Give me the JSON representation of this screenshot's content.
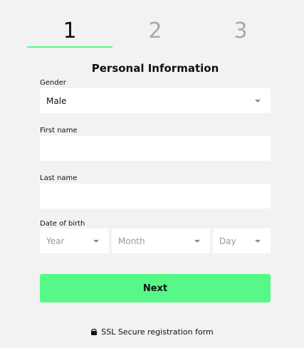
{
  "steps": [
    {
      "label": "1",
      "active": true
    },
    {
      "label": "2",
      "active": false
    },
    {
      "label": "3",
      "active": false
    }
  ],
  "form": {
    "title": "Personal Information",
    "gender": {
      "label": "Gender",
      "value": "Male"
    },
    "first_name": {
      "label": "First name",
      "value": ""
    },
    "last_name": {
      "label": "Last name",
      "value": ""
    },
    "date_of_birth": {
      "label": "Date of birth",
      "year_placeholder": "Year",
      "month_placeholder": "Month",
      "day_placeholder": "Day"
    }
  },
  "buttons": {
    "next_label": "Next"
  },
  "footer": {
    "secure_text": "SSL Secure registration form",
    "icon": "lock-icon"
  },
  "colors": {
    "accent": "#57f887",
    "background": "#f2f2f2",
    "field": "#ffffff",
    "inactive_step": "#a8a8a8"
  }
}
